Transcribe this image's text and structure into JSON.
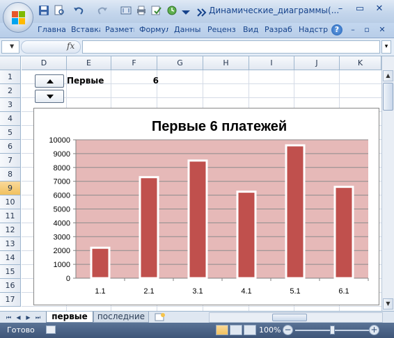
{
  "window": {
    "title": "Динамические_диаграммы(...",
    "minimize": "–",
    "restore": "▭",
    "close": "✕"
  },
  "ribbon": {
    "tabs": [
      "Главная",
      "Вставка",
      "Разметка",
      "Формулы",
      "Данные",
      "Рецензирование",
      "Вид",
      "Разработчик",
      "Надстройки"
    ],
    "tabs_visible": [
      "Главна",
      "Вставка",
      "Разметк",
      "Формул",
      "Данны",
      "Реценз",
      "Вид",
      "Разраб",
      "Надстр"
    ],
    "help": "?",
    "win_min": "–",
    "win_restore": "▫",
    "win_close": "✕"
  },
  "formula_bar": {
    "name_box": "",
    "fx": "fx",
    "formula": ""
  },
  "grid": {
    "columns": [
      "D",
      "E",
      "F",
      "G",
      "H",
      "I",
      "J",
      "K"
    ],
    "rows": [
      "1",
      "2",
      "3",
      "4",
      "5",
      "6",
      "7",
      "8",
      "9",
      "10",
      "11",
      "12",
      "13",
      "14",
      "15",
      "16",
      "17"
    ],
    "selected_row": "9",
    "cells": {
      "E1": "Первые",
      "F1": "6"
    }
  },
  "chart_data": {
    "type": "bar",
    "title": "Первые 6 платежей",
    "categories": [
      "1.1",
      "2.1",
      "3.1",
      "4.1",
      "5.1",
      "6.1"
    ],
    "values": [
      2200,
      7300,
      8500,
      6250,
      9600,
      6600
    ],
    "ylim": [
      0,
      10000
    ],
    "yticks": [
      "0",
      "1000",
      "2000",
      "3000",
      "4000",
      "5000",
      "6000",
      "7000",
      "8000",
      "9000",
      "10000"
    ],
    "grid": true,
    "legend": "none",
    "colors": {
      "bar": "#c0504d",
      "bar_outline": "#ffffff",
      "plot_bg": "#e6b9b8"
    }
  },
  "sheets": {
    "tabs": [
      "первые",
      "последние"
    ],
    "active": "первые"
  },
  "status": {
    "ready": "Готово",
    "zoom": "100%",
    "zoom_level": 0.5
  }
}
